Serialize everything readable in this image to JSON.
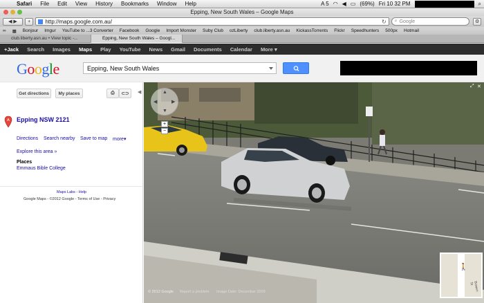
{
  "menubar": {
    "app": "Safari",
    "items": [
      "File",
      "Edit",
      "View",
      "History",
      "Bookmarks",
      "Window",
      "Help"
    ],
    "battery": "(69%)",
    "clock": "Fri 10 32 PM",
    "status_a": "A 5"
  },
  "window": {
    "title": "Epping, New South Wales – Google Maps"
  },
  "toolbar": {
    "url": "http://maps.google.com.au/",
    "search_placeholder": "Google"
  },
  "bookmarks": [
    "Bonjour",
    "Imgur",
    "YouTube to ...3 Converter",
    "Facebook",
    "Google",
    "Import Monster",
    "Suby Club",
    "ozLiberty",
    "club.liberty.asn.au",
    "KickassTorrents",
    "Flickr",
    "Speedhunters",
    "500px",
    "Hotmail"
  ],
  "tabs": [
    {
      "label": "club.liberty.asn.au • View topic -..."
    },
    {
      "label": "Epping, New South Wales – Googl..."
    }
  ],
  "gbar": [
    "+Jack",
    "Search",
    "Images",
    "Maps",
    "Play",
    "YouTube",
    "News",
    "Gmail",
    "Documents",
    "Calendar",
    "More"
  ],
  "header": {
    "logo": "Google",
    "query": "Epping, New South Wales"
  },
  "panel": {
    "get_directions": "Get directions",
    "my_places": "My places",
    "place_title": "Epping NSW 2121",
    "actions": [
      "Directions",
      "Search nearby",
      "Save to map",
      "more"
    ],
    "explore": "Explore this area »",
    "places_heading": "Places",
    "place_item": "Emmaus Bible College",
    "footer_links": "Maps Labs - Help",
    "copyright": "Google Maps - ©2012 Google - Terms of Use - Privacy"
  },
  "map": {
    "copyright": "© 2012 Google",
    "report": "Report a problem",
    "image_date": "Image Date: December 2009",
    "minimap_label": "Bowen St"
  }
}
